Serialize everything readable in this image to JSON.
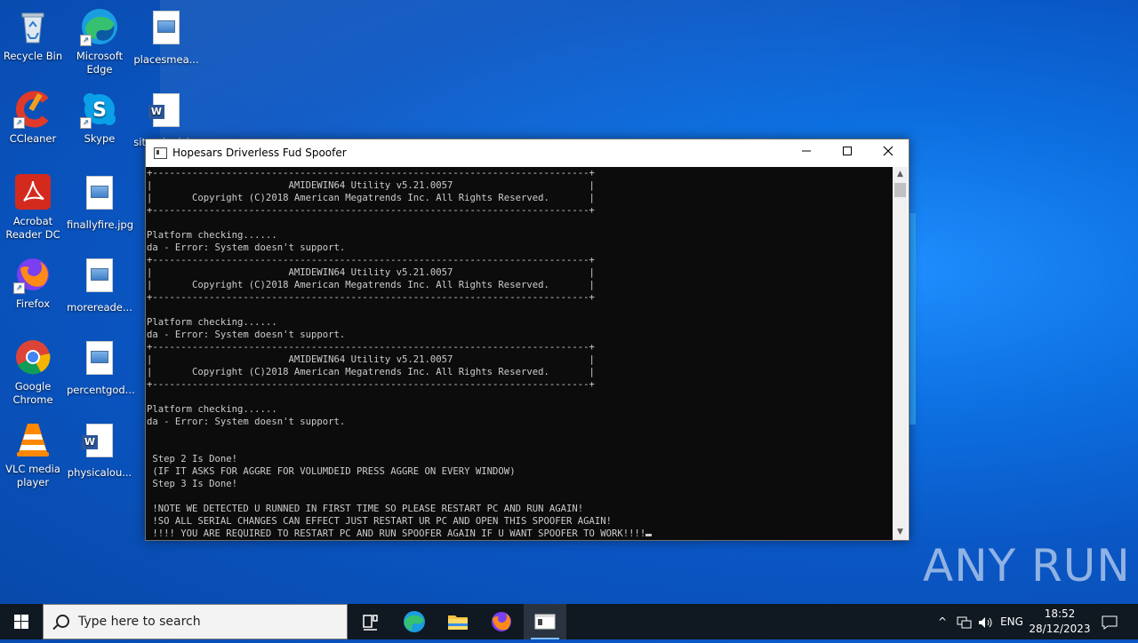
{
  "desktop": {
    "icons": [
      {
        "label": "Recycle Bin"
      },
      {
        "label": "Microsoft\nEdge"
      },
      {
        "label": "placesmea..."
      },
      {
        "label": "CCleaner"
      },
      {
        "label": "Skype"
      },
      {
        "label": "situationisl..."
      },
      {
        "label": "Acrobat\nReader DC"
      },
      {
        "label": "finallyfire.jpg"
      },
      {
        "label": "Firefox"
      },
      {
        "label": "morereade..."
      },
      {
        "label": "Google\nChrome"
      },
      {
        "label": "percentgod..."
      },
      {
        "label": "VLC media\nplayer"
      },
      {
        "label": "physicalou..."
      }
    ]
  },
  "window": {
    "title": "Hopesars Driverless Fud Spoofer",
    "console_lines": [
      "+-----------------------------------------------------------------------------+",
      "|                        AMIDEWIN64 Utility v5.21.0057                        |",
      "|       Copyright (C)2018 American Megatrends Inc. All Rights Reserved.       |",
      "+-----------------------------------------------------------------------------+",
      "",
      "Platform checking......",
      "da - Error: System doesn't support.",
      "+-----------------------------------------------------------------------------+",
      "|                        AMIDEWIN64 Utility v5.21.0057                        |",
      "|       Copyright (C)2018 American Megatrends Inc. All Rights Reserved.       |",
      "+-----------------------------------------------------------------------------+",
      "",
      "Platform checking......",
      "da - Error: System doesn't support.",
      "+-----------------------------------------------------------------------------+",
      "|                        AMIDEWIN64 Utility v5.21.0057                        |",
      "|       Copyright (C)2018 American Megatrends Inc. All Rights Reserved.       |",
      "+-----------------------------------------------------------------------------+",
      "",
      "Platform checking......",
      "da - Error: System doesn't support.",
      "",
      "",
      " Step 2 Is Done!",
      " (IF IT ASKS FOR AGGRE FOR VOLUMDEID PRESS AGGRE ON EVERY WINDOW)",
      " Step 3 Is Done!",
      "",
      " !NOTE WE DETECTED U RUNNED IN FIRST TIME SO PLEASE RESTART PC AND RUN AGAIN!",
      " !SO ALL SERIAL CHANGES CAN EFFECT JUST RESTART UR PC AND OPEN THIS SPOOFER AGAIN!",
      " !!!! YOU ARE REQUIRED TO RESTART PC AND RUN SPOOFER AGAIN IF U WANT SPOOFER TO WORK!!!!"
    ]
  },
  "watermark": "ANY RUN",
  "taskbar": {
    "search_placeholder": "Type here to search",
    "language": "ENG",
    "time": "18:52",
    "date": "28/12/2023"
  }
}
